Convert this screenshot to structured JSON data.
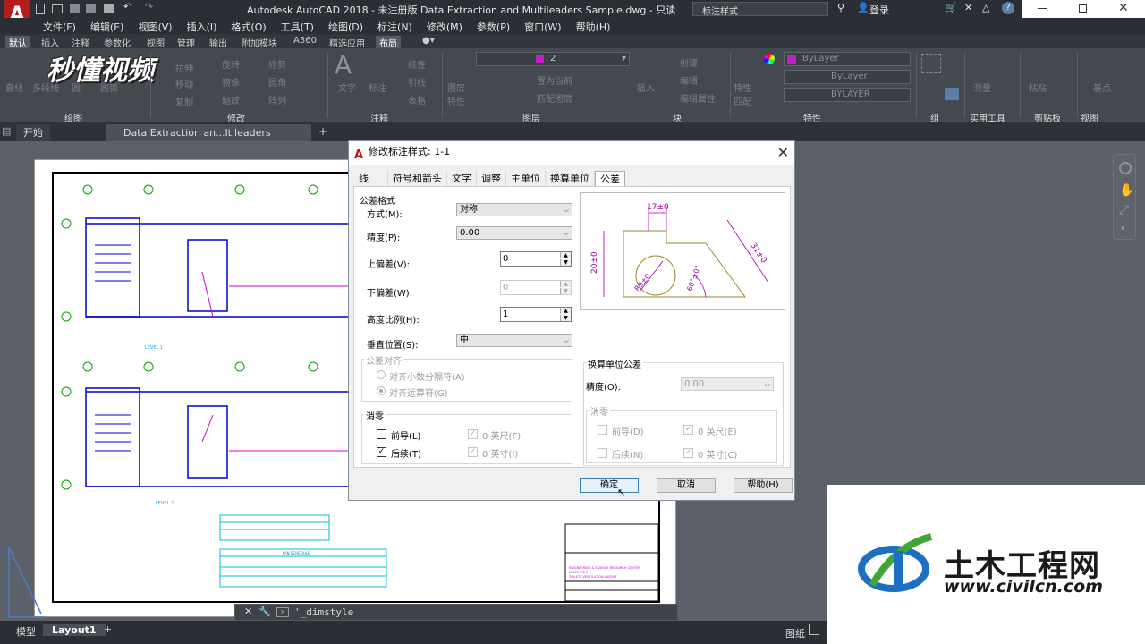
{
  "app": {
    "logo": "A",
    "title": "Autodesk AutoCAD 2018 - 未注册版    Data Extraction and Multileaders Sample.dwg - 只读",
    "search_placeholder": "标注样式",
    "login": "登录",
    "help": "?"
  },
  "menu": [
    "文件(F)",
    "编辑(E)",
    "视图(V)",
    "插入(I)",
    "格式(O)",
    "工具(T)",
    "绘图(D)",
    "标注(N)",
    "修改(M)",
    "参数(P)",
    "窗口(W)",
    "帮助(H)"
  ],
  "ribbon_tabs": [
    "默认",
    "插入",
    "注释",
    "参数化",
    "视图",
    "管理",
    "输出",
    "附加模块",
    "A360",
    "精选应用",
    "布局"
  ],
  "ribbon_active": "默认",
  "ribbon_groups": [
    "绘图",
    "修改",
    "注释",
    "图层",
    "块",
    "特性",
    "组",
    "实用工具",
    "剪贴板",
    "视图"
  ],
  "ribbon_ghost": {
    "draw": [
      "直线",
      "多段线",
      "圆",
      "圆弧"
    ],
    "modify": [
      "移动",
      "旋转",
      "修剪",
      "复制",
      "镜像",
      "圆角",
      "拉伸",
      "缩放",
      "阵列"
    ],
    "annotation": [
      "文字",
      "标注",
      "线性",
      "引线",
      "表格"
    ],
    "layer": [
      "图层特性",
      "置为当前",
      "匹配图层"
    ],
    "block": [
      "插入",
      "创建",
      "编辑",
      "编辑属性"
    ],
    "properties": [
      "特性匹配",
      "ByLayer",
      "ByLayer",
      "BYLAYER"
    ],
    "utilities": [
      "测量"
    ],
    "clipboard": [
      "粘贴"
    ],
    "view": [
      "基点"
    ]
  },
  "layer_combo": "2",
  "doc_tabs": [
    {
      "label": "开始",
      "active": false
    },
    {
      "label": "Data Extraction an...ltileaders Sample*",
      "active": true
    }
  ],
  "watermark": "秒懂视频",
  "drawing": {
    "level1": "LEVEL 1",
    "level2": "LEVEL 2",
    "fan_schedule": "FAN SCHEDULE",
    "title_block": [
      "ENGINEERING & SCIENCE RESEARCH CENTER",
      "LEVEL 1 & 2",
      "TOILETS VENTILATION LAYOUT"
    ]
  },
  "dialog": {
    "title": "修改标注样式: 1-1",
    "tabs": [
      "线",
      "符号和箭头",
      "文字",
      "调整",
      "主单位",
      "换算单位",
      "公差"
    ],
    "active_tab": "公差",
    "tol_format": {
      "title": "公差格式",
      "method_label": "方式(M):",
      "method_value": "对称",
      "precision_label": "精度(P):",
      "precision_value": "0.00",
      "upper_label": "上偏差(V):",
      "upper_value": "0",
      "lower_label": "下偏差(W):",
      "lower_value": "0",
      "scale_label": "高度比例(H):",
      "scale_value": "1",
      "vpos_label": "垂直位置(S):",
      "vpos_value": "中"
    },
    "align": {
      "title": "公差对齐",
      "opt1": "对齐小数分隔符(A)",
      "opt2": "对齐运算符(G)"
    },
    "zero": {
      "title": "消零",
      "leading": "前导(L)",
      "trailing": "后续(T)",
      "feet": "0 英尺(F)",
      "inches": "0 英寸(I)",
      "leading_checked": false,
      "trailing_checked": true
    },
    "alt": {
      "title": "换算单位公差",
      "precision_label": "精度(O):",
      "precision_value": "0.00",
      "zero_title": "消零",
      "leading": "前导(D)",
      "trailing": "后续(N)",
      "feet": "0 英尺(E)",
      "inches": "0 英寸(C)"
    },
    "preview": {
      "top": "17±0",
      "left": "20±0",
      "right": "31±0",
      "radius": "R9±0",
      "angle": "60°±0°"
    },
    "buttons": {
      "ok": "确定",
      "cancel": "取消",
      "help": "帮助(H)"
    }
  },
  "command": {
    "text": "'_dimstyle"
  },
  "layout_tabs": [
    "模型",
    "Layout1"
  ],
  "status": {
    "paper": "图纸"
  },
  "civil": {
    "name": "土木工程网",
    "url": "www.civilcn.com"
  },
  "colors": {
    "accent": "#c01010",
    "ribbon_bg": "#44484f",
    "dialog_bg": "#f0f0f0",
    "civil_blue": "#1d6fc1",
    "civil_green": "#3fa535"
  }
}
